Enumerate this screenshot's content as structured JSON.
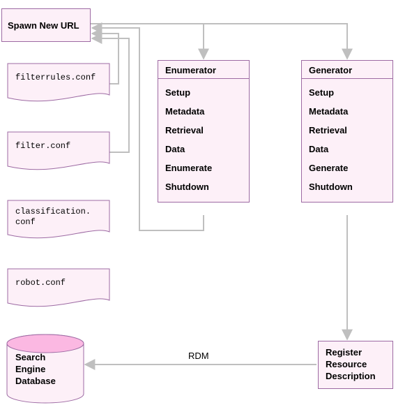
{
  "spawn": {
    "label": "Spawn New URL"
  },
  "docs": {
    "filterrules": "filterrules.conf",
    "filter": "filter.conf",
    "classification": "classification.\nconf",
    "robot": "robot.conf"
  },
  "enumerator": {
    "title": "Enumerator",
    "items": [
      "Setup",
      "Metadata",
      "Retrieval",
      "Data",
      "Enumerate",
      "Shutdown"
    ]
  },
  "generator": {
    "title": "Generator",
    "items": [
      "Setup",
      "Metadata",
      "Retrieval",
      "Data",
      "Generate",
      "Shutdown"
    ]
  },
  "register": {
    "line1": "Register",
    "line2": "Resource",
    "line3": "Description"
  },
  "database": {
    "line1": "Search",
    "line2": "Engine",
    "line3": "Database"
  },
  "edges": {
    "rdm": "RDM"
  },
  "colors": {
    "fill": "#fdf0f8",
    "stroke": "#9d6aa3",
    "arrow": "#bfbfbf"
  },
  "chart_data": {
    "type": "diagram",
    "nodes": [
      {
        "id": "spawn",
        "label": "Spawn New URL",
        "kind": "process"
      },
      {
        "id": "filterrules",
        "label": "filterrules.conf",
        "kind": "file"
      },
      {
        "id": "filter",
        "label": "filter.conf",
        "kind": "file"
      },
      {
        "id": "classification",
        "label": "classification.conf",
        "kind": "file"
      },
      {
        "id": "robot",
        "label": "robot.conf",
        "kind": "file"
      },
      {
        "id": "enumerator",
        "label": "Enumerator",
        "kind": "module",
        "items": [
          "Setup",
          "Metadata",
          "Retrieval",
          "Data",
          "Enumerate",
          "Shutdown"
        ]
      },
      {
        "id": "generator",
        "label": "Generator",
        "kind": "module",
        "items": [
          "Setup",
          "Metadata",
          "Retrieval",
          "Data",
          "Generate",
          "Shutdown"
        ]
      },
      {
        "id": "register",
        "label": "Register Resource Description",
        "kind": "process"
      },
      {
        "id": "database",
        "label": "Search Engine Database",
        "kind": "datastore"
      }
    ],
    "edges": [
      {
        "from": "spawn",
        "to": "enumerator"
      },
      {
        "from": "spawn",
        "to": "generator"
      },
      {
        "from": "enumerator",
        "to": "spawn"
      },
      {
        "from": "generator",
        "to": "register"
      },
      {
        "from": "register",
        "to": "database",
        "label": "RDM"
      },
      {
        "from": "filterrules",
        "to": "spawn"
      },
      {
        "from": "filter",
        "to": "spawn"
      }
    ]
  }
}
